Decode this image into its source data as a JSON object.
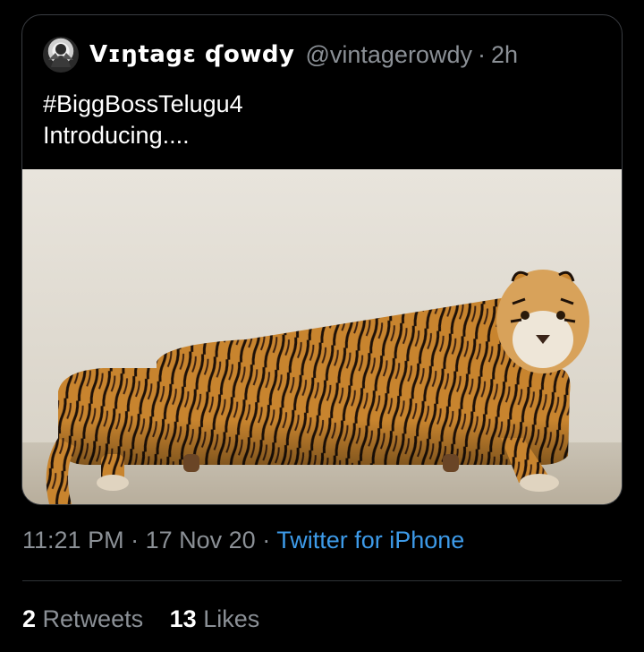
{
  "quoted_tweet": {
    "author": {
      "display_name": "Vɪŋtagɛ ʠowdy",
      "handle": "@vintagerowdy",
      "avatar_icon": "user-avatar"
    },
    "separator": "·",
    "time_ago": "2h",
    "text_lines": [
      "#BiggBossTelugu4",
      "Introducing...."
    ],
    "media": {
      "kind": "photo",
      "subject_icon": "tiger-sofa-photo"
    }
  },
  "tweet_meta": {
    "time": "11:21 PM",
    "date": "17 Nov 20",
    "separator": "·",
    "source": "Twitter for iPhone"
  },
  "stats": {
    "retweets_count": "2",
    "retweets_label": "Retweets",
    "likes_count": "13",
    "likes_label": "Likes"
  },
  "colors": {
    "background": "#000000",
    "text_primary": "#ffffff",
    "text_secondary": "#8b9096",
    "link": "#3d9ae8",
    "border": "#3a3d42"
  }
}
